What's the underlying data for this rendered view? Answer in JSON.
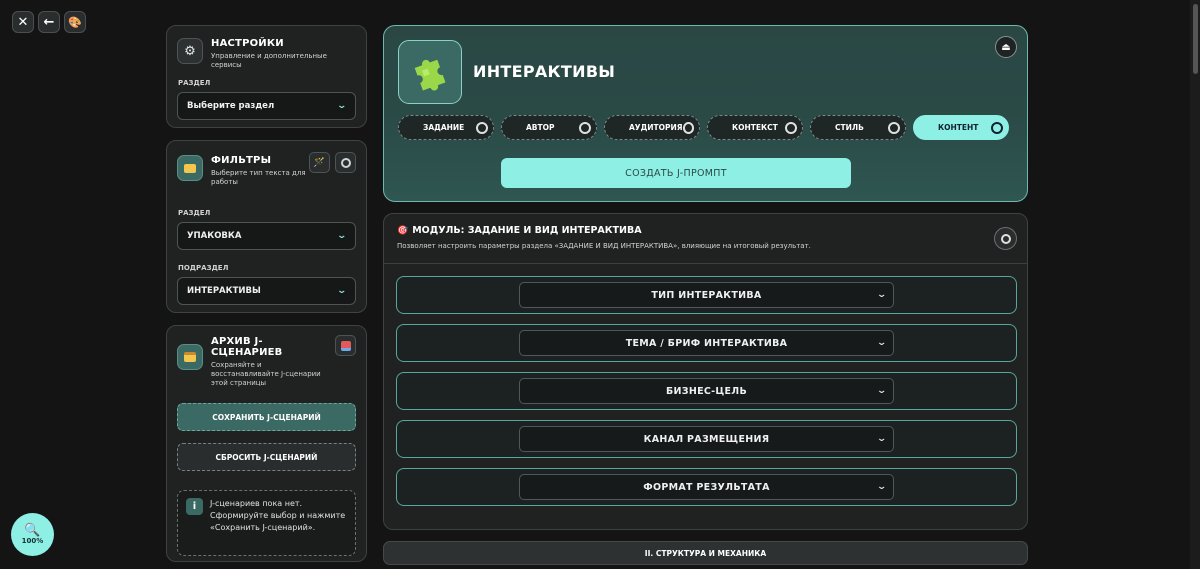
{
  "toolbar": {
    "close_icon": "close-icon",
    "back_icon": "back-arrow-icon",
    "palette_icon": "palette-icon"
  },
  "zoom": {
    "label": "100%",
    "icon": "magnifier-icon"
  },
  "settings": {
    "title": "НАСТРОЙКИ",
    "subtitle": "Управление и дополнительные сервисы",
    "section_label": "РАЗДЕЛ",
    "section_value": "Выберите раздел"
  },
  "filters": {
    "title": "ФИЛЬТРЫ",
    "subtitle": "Выберите тип текста для работы",
    "section_label": "РАЗДЕЛ",
    "section_value": "УПАКОВКА",
    "subsection_label": "ПОДРАЗДЕЛ",
    "subsection_value": "ИНТЕРАКТИВЫ"
  },
  "archive": {
    "title": "АРХИВ J-СЦЕНАРИЕВ",
    "subtitle": "Сохраняйте и восстанавливайте J-сценарии этой страницы",
    "save_label": "СОХРАНИТЬ J-СЦЕНАРИЙ",
    "reset_label": "СБРОСИТЬ J-СЦЕНАРИЙ",
    "info_icon_label": "i",
    "empty_text": "J-сценариев пока нет. Сформируйте выбор и нажмите «Сохранить J-сценарий»."
  },
  "hero": {
    "title": "ИНТЕРАКТИВЫ",
    "logo_icon": "puzzle-icon",
    "pills": [
      {
        "label": "ЗАДАНИЕ",
        "active": false
      },
      {
        "label": "АВТОР",
        "active": false
      },
      {
        "label": "АУДИТОРИЯ",
        "active": false
      },
      {
        "label": "КОНТЕКСТ",
        "active": false
      },
      {
        "label": "СТИЛЬ",
        "active": false
      },
      {
        "label": "КОНТЕНТ",
        "active": true
      }
    ],
    "cta_label": "СОЗДАТЬ J-ПРОМПТ"
  },
  "module": {
    "title": "МОДУЛЬ: ЗАДАНИЕ И ВИД ИНТЕРАКТИВА",
    "subtitle": "Позволяет настроить параметры раздела «ЗАДАНИЕ И ВИД ИНТЕРАКТИВА», влияющие на итоговый результат.",
    "rows": [
      {
        "label": "ТИП ИНТЕРАКТИВА"
      },
      {
        "label": "ТЕМА / БРИФ ИНТЕРАКТИВА"
      },
      {
        "label": "БИЗНЕС-ЦЕЛЬ"
      },
      {
        "label": "КАНАЛ РАЗМЕЩЕНИЯ"
      },
      {
        "label": "ФОРМАТ РЕЗУЛЬТАТА"
      }
    ]
  },
  "section2": {
    "label": "II. СТРУКТУРА И МЕХАНИКА"
  },
  "colors": {
    "accent": "#8ef0e4",
    "teal": "#3b6a64",
    "bg": "#141414",
    "card": "#202222"
  }
}
